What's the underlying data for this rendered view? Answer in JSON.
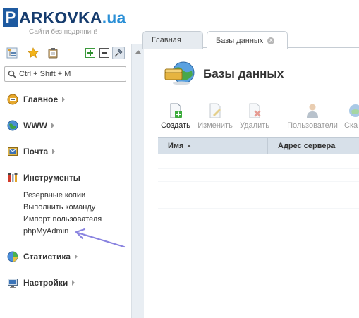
{
  "header": {
    "logo_p": "P",
    "logo_main": "ARKOVKA",
    "logo_tld": ".ua",
    "tagline": "Сайти без подряпин!"
  },
  "sidebar": {
    "toolbar": [
      "tree-icon",
      "star-icon",
      "clipboard-icon",
      "expand-plus-icon",
      "collapse-minus-icon",
      "pin-icon"
    ],
    "search_placeholder": "Ctrl + Shift + M",
    "sections": [
      {
        "label": "Главное",
        "icon": "home-icon"
      },
      {
        "label": "WWW",
        "icon": "globe-icon"
      },
      {
        "label": "Почта",
        "icon": "mail-icon"
      },
      {
        "label": "Инструменты",
        "icon": "tools-icon"
      },
      {
        "label": "Статистика",
        "icon": "stats-icon"
      },
      {
        "label": "Настройки",
        "icon": "settings-icon"
      }
    ],
    "tools_items": [
      "Резервные копии",
      "Выполнить команду",
      "Импорт пользователя",
      "phpMyAdmin"
    ]
  },
  "tabs": [
    {
      "label": "Главная"
    },
    {
      "label": "Базы данных",
      "closable": true
    }
  ],
  "main": {
    "title": "Базы данных",
    "actions": [
      {
        "label": "Создать",
        "icon": "create-db-icon",
        "enabled": true
      },
      {
        "label": "Изменить",
        "icon": "edit-icon",
        "enabled": false
      },
      {
        "label": "Удалить",
        "icon": "delete-icon",
        "enabled": false
      },
      {
        "label": "Пользователи",
        "icon": "users-icon",
        "enabled": false
      },
      {
        "label": "Ска",
        "icon": "download-icon",
        "enabled": false
      }
    ],
    "table": {
      "columns": [
        "Имя",
        "Адрес сервера"
      ]
    }
  },
  "colors": {
    "accent_blue": "#1e5aa0",
    "tld_blue": "#2a8fd6",
    "header_row": "#d7e0e9",
    "annotation": "#8a84e0"
  }
}
